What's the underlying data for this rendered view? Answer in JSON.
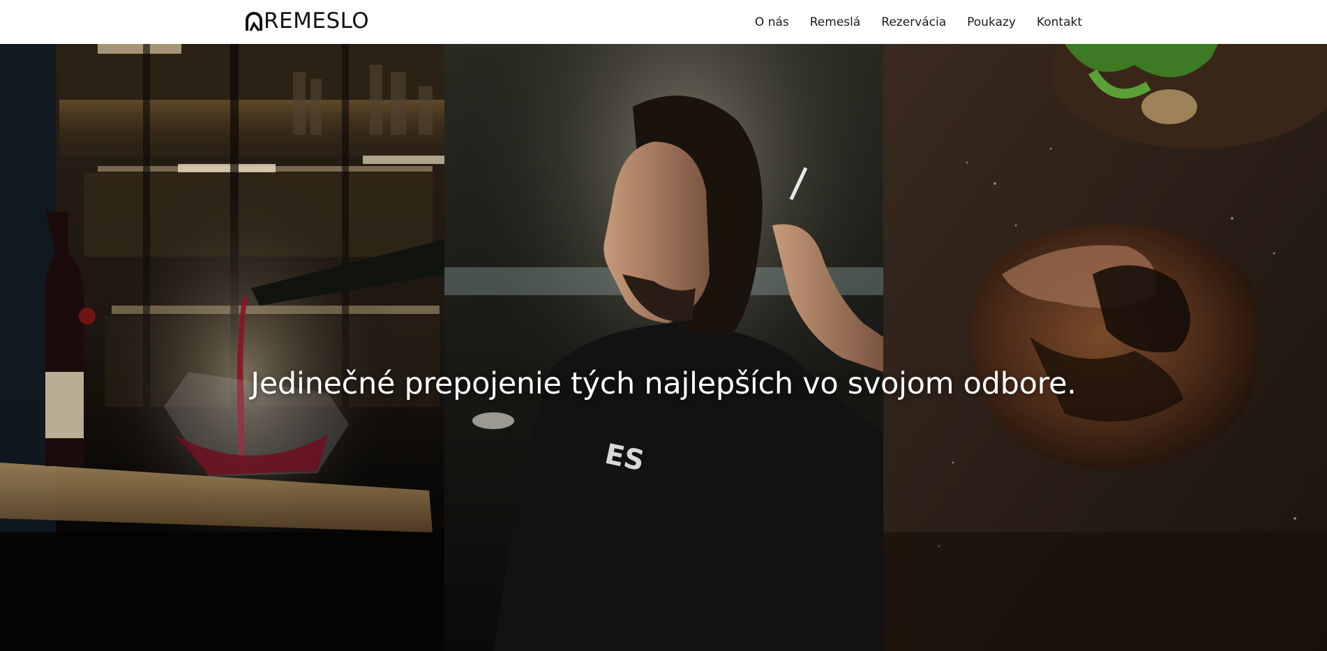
{
  "header": {
    "logo_text": "REMESLO",
    "nav": [
      {
        "label": "O nás"
      },
      {
        "label": "Remeslá"
      },
      {
        "label": "Rezervácia"
      },
      {
        "label": "Poukazy"
      },
      {
        "label": "Kontakt"
      }
    ]
  },
  "hero": {
    "headline": "Jedinečné prepojenie tých najlepších vo svojom odbore."
  },
  "theme": {
    "header_bg": "#ffffff",
    "text_dark": "#111111",
    "hero_text": "#ffffff"
  }
}
